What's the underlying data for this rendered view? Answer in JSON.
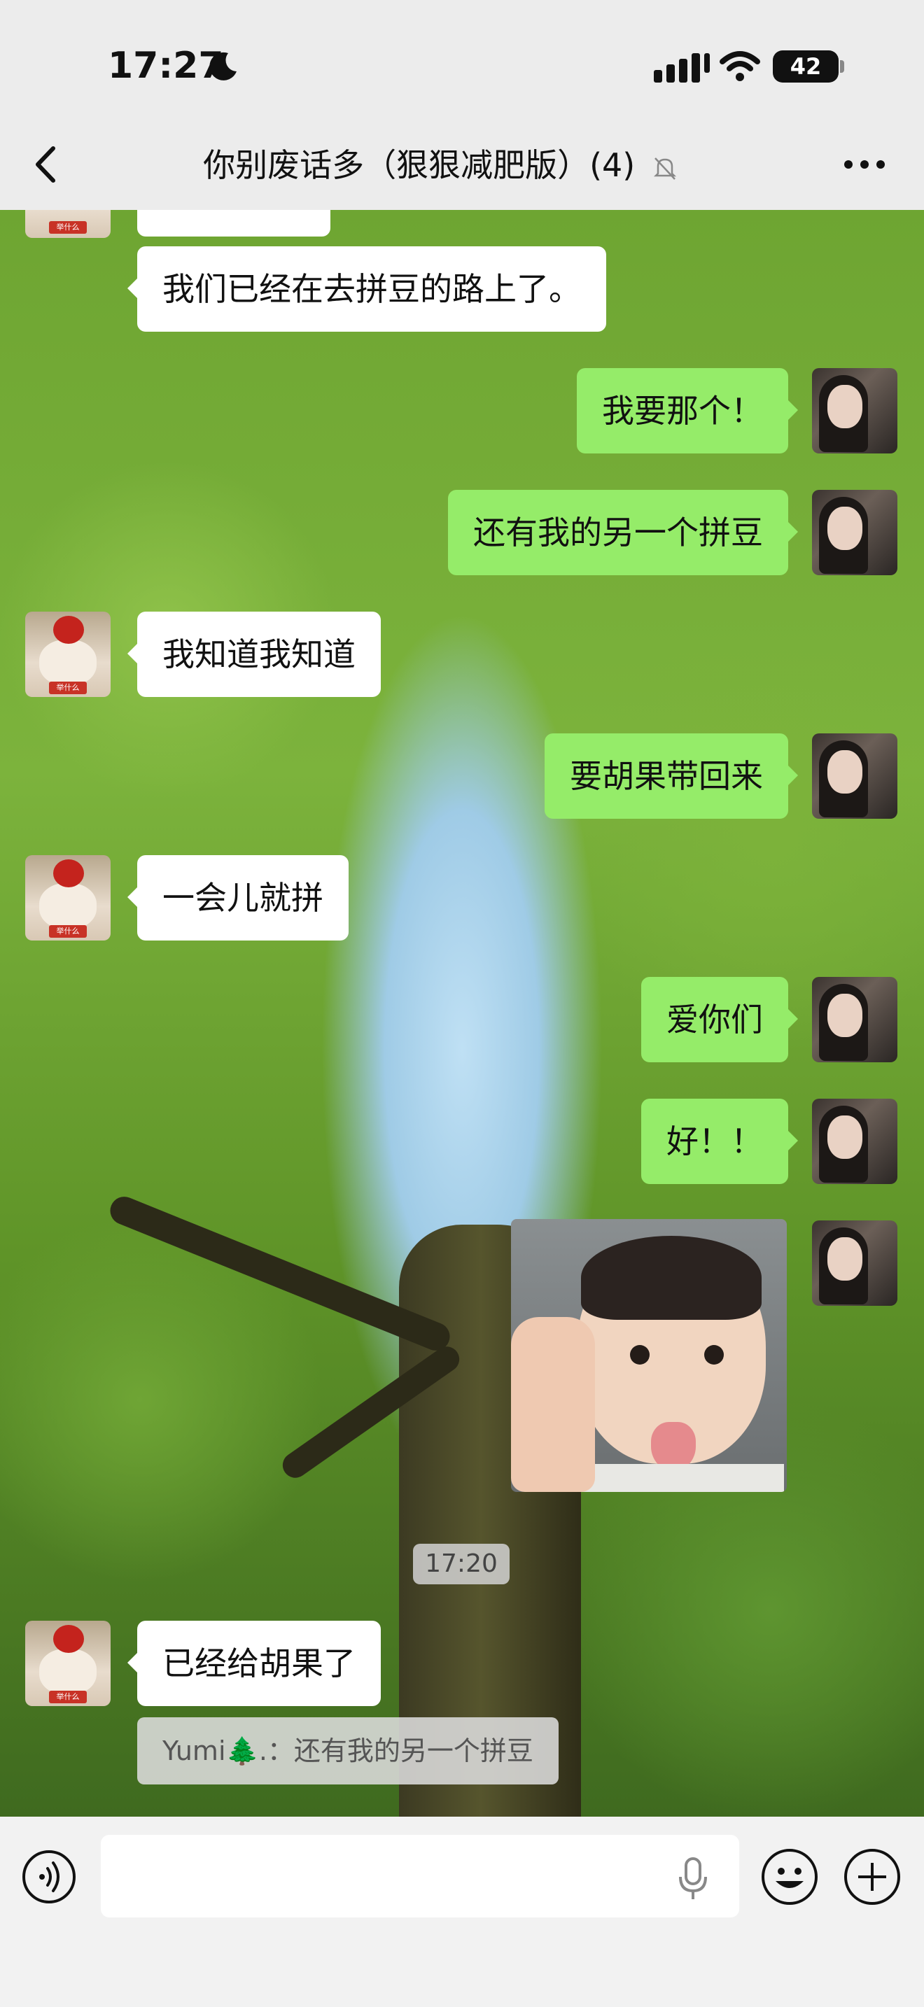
{
  "status_bar": {
    "time": "17:27",
    "battery": "42"
  },
  "nav": {
    "title": "你别废话多（狠狠减肥版）(4)",
    "mute_icon": "bell-slash-icon",
    "back_icon": "chevron-left-icon",
    "more_icon": "ellipsis-icon"
  },
  "avatar_tag": "举什么",
  "messages": [
    {
      "from": "other",
      "text": "我们已经在去拼豆的路上了。"
    },
    {
      "from": "me",
      "text": "我要那个！"
    },
    {
      "from": "me",
      "text": "还有我的另一个拼豆"
    },
    {
      "from": "other",
      "text": "我知道我知道"
    },
    {
      "from": "me",
      "text": "要胡果带回来"
    },
    {
      "from": "other",
      "text": "一会儿就拼"
    },
    {
      "from": "me",
      "text": "爱你们"
    },
    {
      "from": "me",
      "text": "好！！"
    },
    {
      "from": "me",
      "type": "image",
      "text": ""
    },
    {
      "from": "other",
      "text": "已经给胡果了"
    }
  ],
  "timestamp": "17:20",
  "quote": "Yumi🌲.：还有我的另一个拼豆",
  "input_bar": {
    "voice_icon": "voice-icon",
    "mic_icon": "microphone-icon",
    "emoji_icon": "emoji-icon",
    "plus_icon": "plus-icon"
  }
}
